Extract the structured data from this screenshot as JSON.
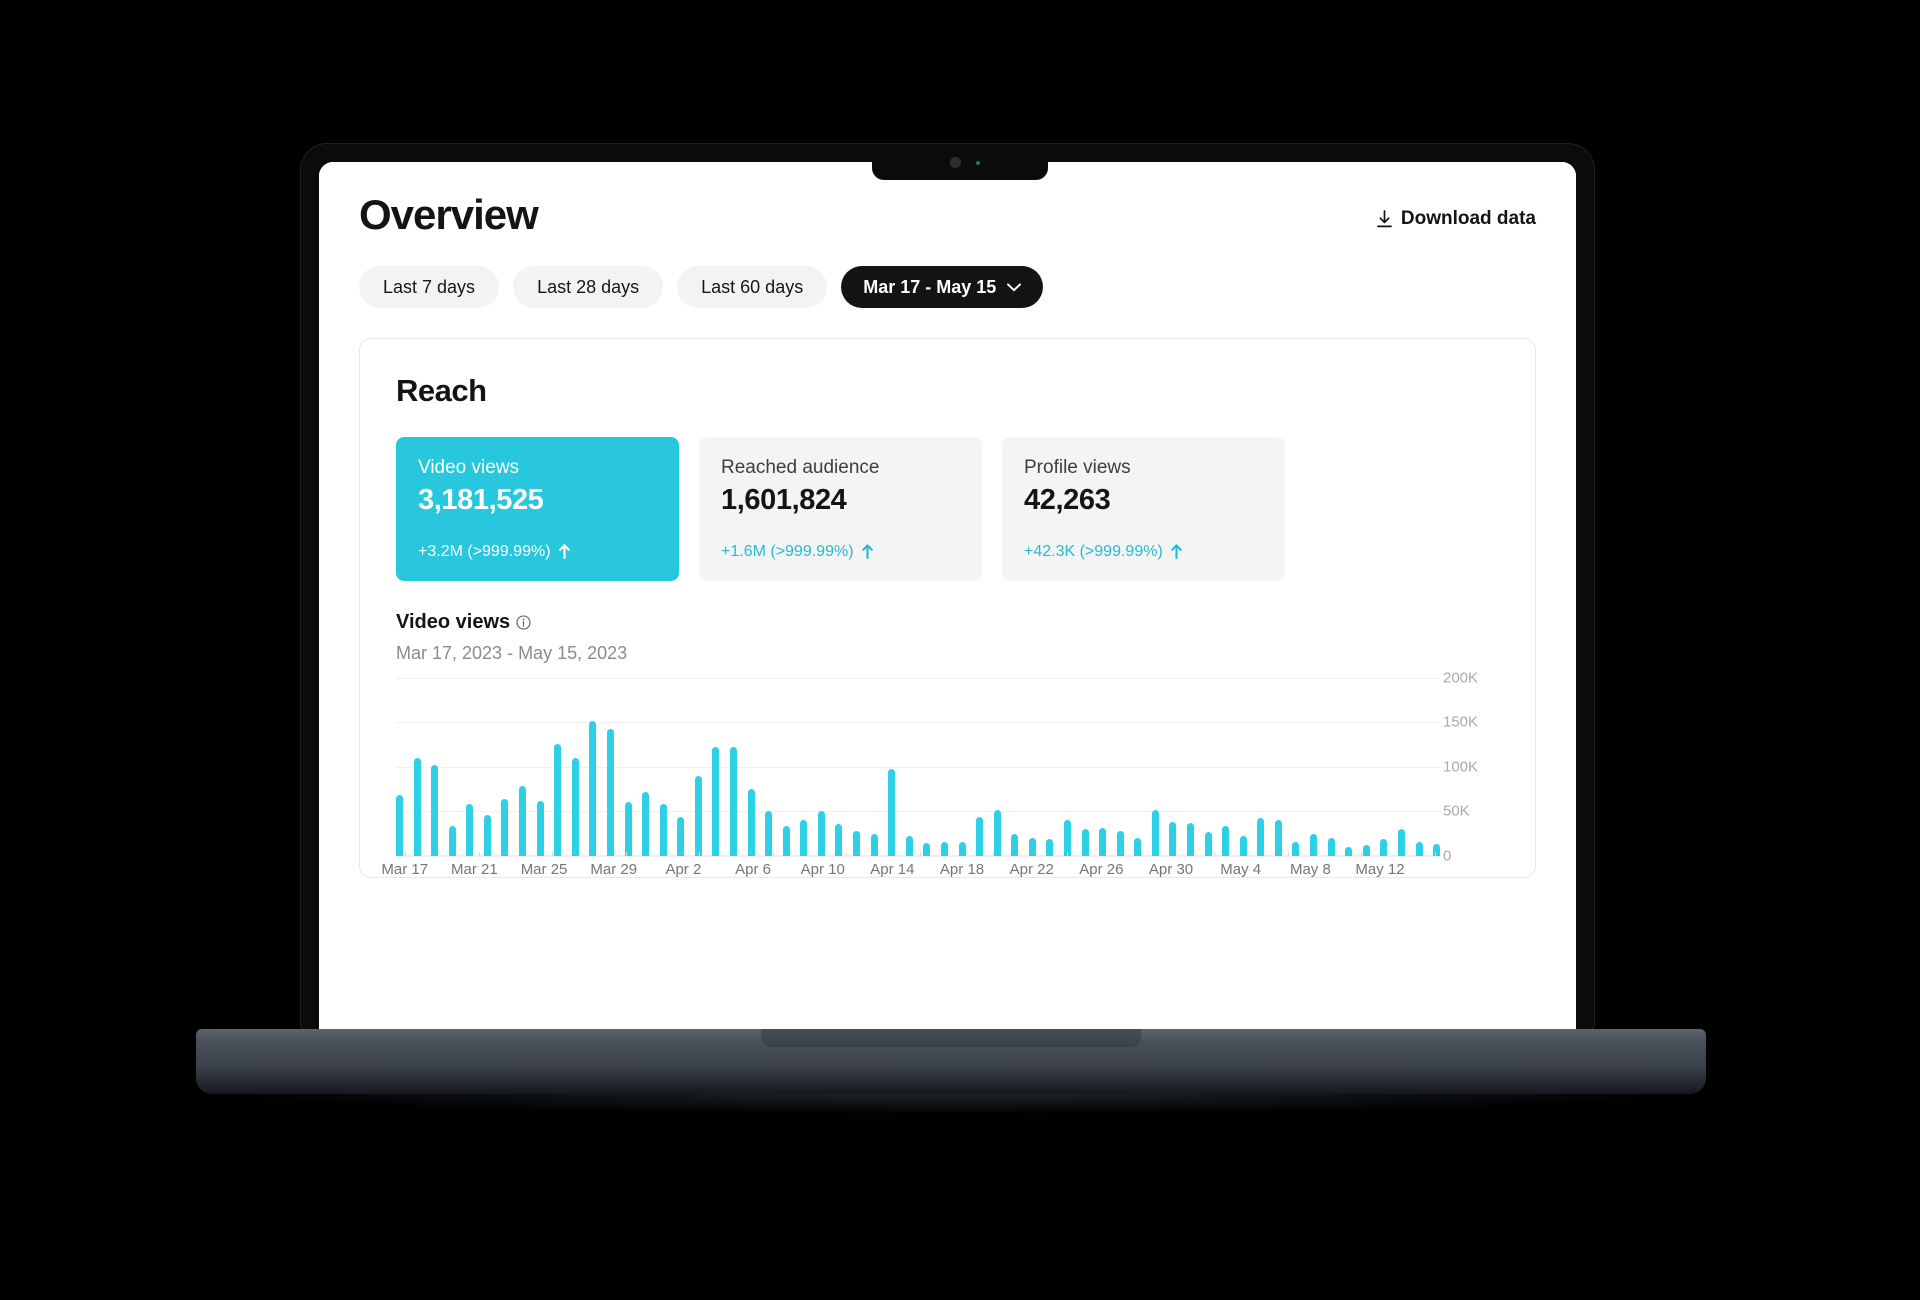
{
  "header": {
    "title": "Overview",
    "download_label": "Download data",
    "download_icon": "download-icon"
  },
  "filters": {
    "pills": [
      {
        "label": "Last 7 days",
        "active": false
      },
      {
        "label": "Last 28 days",
        "active": false
      },
      {
        "label": "Last 60 days",
        "active": false
      },
      {
        "label": "Mar 17 - May 15",
        "active": true,
        "icon": "chevron-down-icon"
      }
    ]
  },
  "reach": {
    "section_title": "Reach",
    "metrics": [
      {
        "label": "Video views",
        "value": "3,181,525",
        "delta": "+3.2M  (>999.99%)",
        "trend": "up-arrow-icon",
        "selected": true
      },
      {
        "label": "Reached audience",
        "value": "1,601,824",
        "delta": "+1.6M  (>999.99%)",
        "trend": "up-arrow-icon",
        "selected": false
      },
      {
        "label": "Profile views",
        "value": "42,263",
        "delta": "+42.3K  (>999.99%)",
        "trend": "up-arrow-icon",
        "selected": false
      }
    ],
    "chart_heading": "Video views",
    "chart_heading_icon": "info-icon",
    "chart_subtitle": "Mar 17, 2023 - May 15, 2023"
  },
  "colors": {
    "accent": "#2ed0e6",
    "accent_card": "#28c7dd",
    "accent_text": "#23bcd2",
    "ink": "#141414",
    "muted": "#8b8b90",
    "pill_bg": "#f3f3f4",
    "card_bg": "#f4f4f5"
  },
  "chart_data": {
    "type": "bar",
    "title": "Video views",
    "subtitle": "Mar 17, 2023 - May 15, 2023",
    "xlabel": "",
    "ylabel": "",
    "ylim": [
      0,
      200000
    ],
    "grid": true,
    "legend": "none",
    "ytick_labels": [
      "200K",
      "150K",
      "100K",
      "50K",
      "0"
    ],
    "ytick_values": [
      200000,
      150000,
      100000,
      50000,
      0
    ],
    "xtick_labels": [
      "Mar 17",
      "Mar 21",
      "Mar 25",
      "Mar 29",
      "Apr 2",
      "Apr 6",
      "Apr 10",
      "Apr 14",
      "Apr 18",
      "Apr 22",
      "Apr 26",
      "Apr 30",
      "May 4",
      "May 8",
      "May 12"
    ],
    "xtick_indices": [
      0,
      4,
      8,
      12,
      16,
      20,
      24,
      28,
      32,
      36,
      40,
      44,
      48,
      52,
      56
    ],
    "categories": [
      "Mar 17",
      "Mar 18",
      "Mar 19",
      "Mar 20",
      "Mar 21",
      "Mar 22",
      "Mar 23",
      "Mar 24",
      "Mar 25",
      "Mar 26",
      "Mar 27",
      "Mar 28",
      "Mar 29",
      "Mar 30",
      "Mar 31",
      "Apr 1",
      "Apr 2",
      "Apr 3",
      "Apr 4",
      "Apr 5",
      "Apr 6",
      "Apr 7",
      "Apr 8",
      "Apr 9",
      "Apr 10",
      "Apr 11",
      "Apr 12",
      "Apr 13",
      "Apr 14",
      "Apr 15",
      "Apr 16",
      "Apr 17",
      "Apr 18",
      "Apr 19",
      "Apr 20",
      "Apr 21",
      "Apr 22",
      "Apr 23",
      "Apr 24",
      "Apr 25",
      "Apr 26",
      "Apr 27",
      "Apr 28",
      "Apr 29",
      "Apr 30",
      "May 1",
      "May 2",
      "May 3",
      "May 4",
      "May 5",
      "May 6",
      "May 7",
      "May 8",
      "May 9",
      "May 10",
      "May 11",
      "May 12",
      "May 13",
      "May 14",
      "May 15"
    ],
    "values": [
      68000,
      110000,
      102000,
      33000,
      58000,
      46000,
      64000,
      79000,
      62000,
      126000,
      110000,
      152000,
      142000,
      60000,
      72000,
      58000,
      44000,
      90000,
      122000,
      122000,
      75000,
      50000,
      33000,
      40000,
      50000,
      36000,
      28000,
      24000,
      97000,
      22000,
      14000,
      15000,
      16000,
      44000,
      52000,
      24000,
      20000,
      19000,
      40000,
      30000,
      31000,
      28000,
      20000,
      51000,
      38000,
      37000,
      27000,
      33000,
      22000,
      43000,
      40000,
      16000,
      24000,
      20000,
      10000,
      12000,
      19000,
      30000,
      16000,
      13000
    ]
  }
}
